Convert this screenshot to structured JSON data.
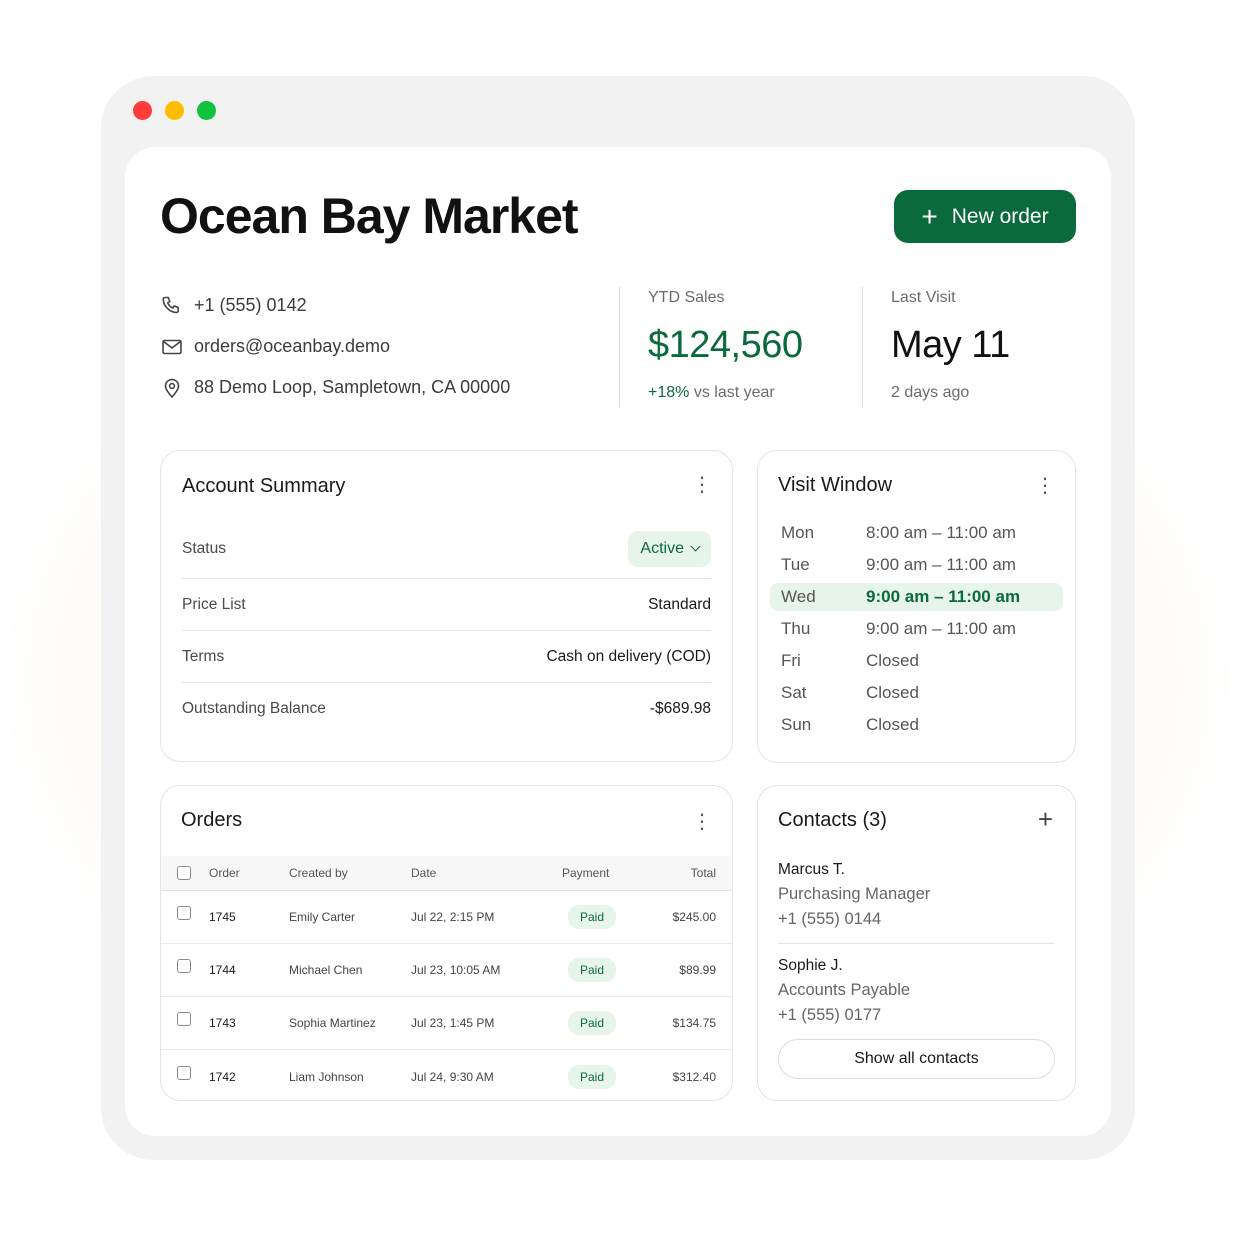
{
  "header": {
    "title": "Ocean Bay Market",
    "new_order_label": "New order"
  },
  "contact_info": {
    "phone": "+1 (555) 0142",
    "email": "orders@oceanbay.demo",
    "address": "88 Demo Loop, Sampletown, CA 00000"
  },
  "stats": {
    "ytd_label": "YTD Sales",
    "ytd_value": "$124,560",
    "ytd_delta": "+18%",
    "ytd_delta_suffix": " vs last year",
    "visit_label": "Last Visit",
    "visit_value": "May 11",
    "visit_sub": "2 days ago"
  },
  "account_summary": {
    "title": "Account Summary",
    "status_label": "Status",
    "status_value": "Active",
    "price_list_label": "Price List",
    "price_list_value": "Standard",
    "terms_label": "Terms",
    "terms_value": "Cash on delivery (COD)",
    "balance_label": "Outstanding Balance",
    "balance_value": "-$689.98"
  },
  "visit_window": {
    "title": "Visit Window",
    "days": [
      {
        "day": "Mon",
        "time": "8:00 am – 11:00 am"
      },
      {
        "day": "Tue",
        "time": "9:00 am – 11:00 am"
      },
      {
        "day": "Wed",
        "time": "9:00 am – 11:00 am"
      },
      {
        "day": "Thu",
        "time": "9:00 am – 11:00 am"
      },
      {
        "day": "Fri",
        "time": "Closed"
      },
      {
        "day": "Sat",
        "time": "Closed"
      },
      {
        "day": "Sun",
        "time": "Closed"
      }
    ]
  },
  "orders": {
    "title": "Orders",
    "columns": {
      "order": "Order",
      "created_by": "Created by",
      "date": "Date",
      "payment": "Payment",
      "total": "Total"
    },
    "rows": [
      {
        "order": "1745",
        "created_by": "Emily Carter",
        "date": "Jul 22, 2:15 PM",
        "payment": "Paid",
        "total": "$245.00"
      },
      {
        "order": "1744",
        "created_by": "Michael Chen",
        "date": "Jul 23, 10:05 AM",
        "payment": "Paid",
        "total": "$89.99"
      },
      {
        "order": "1743",
        "created_by": "Sophia Martinez",
        "date": "Jul 23, 1:45 PM",
        "payment": "Paid",
        "total": "$134.75"
      },
      {
        "order": "1742",
        "created_by": "Liam Johnson",
        "date": "Jul 24, 9:30 AM",
        "payment": "Paid",
        "total": "$312.40"
      }
    ]
  },
  "contacts": {
    "title": "Contacts (3)",
    "list": [
      {
        "name": "Marcus T.",
        "role": "Purchasing Manager",
        "phone": "+1 (555) 0144"
      },
      {
        "name": "Sophie J.",
        "role": "Accounts Payable",
        "phone": "+1 (555) 0177"
      }
    ],
    "show_all_label": "Show all contacts"
  },
  "colors": {
    "accent": "#0b6a3b",
    "accent_bg": "#e6f4ea"
  },
  "icons": {
    "phone": "phone-icon",
    "email": "mail-icon",
    "address": "map-pin-icon",
    "menu": "kebab-menu-icon",
    "add": "plus-icon"
  }
}
